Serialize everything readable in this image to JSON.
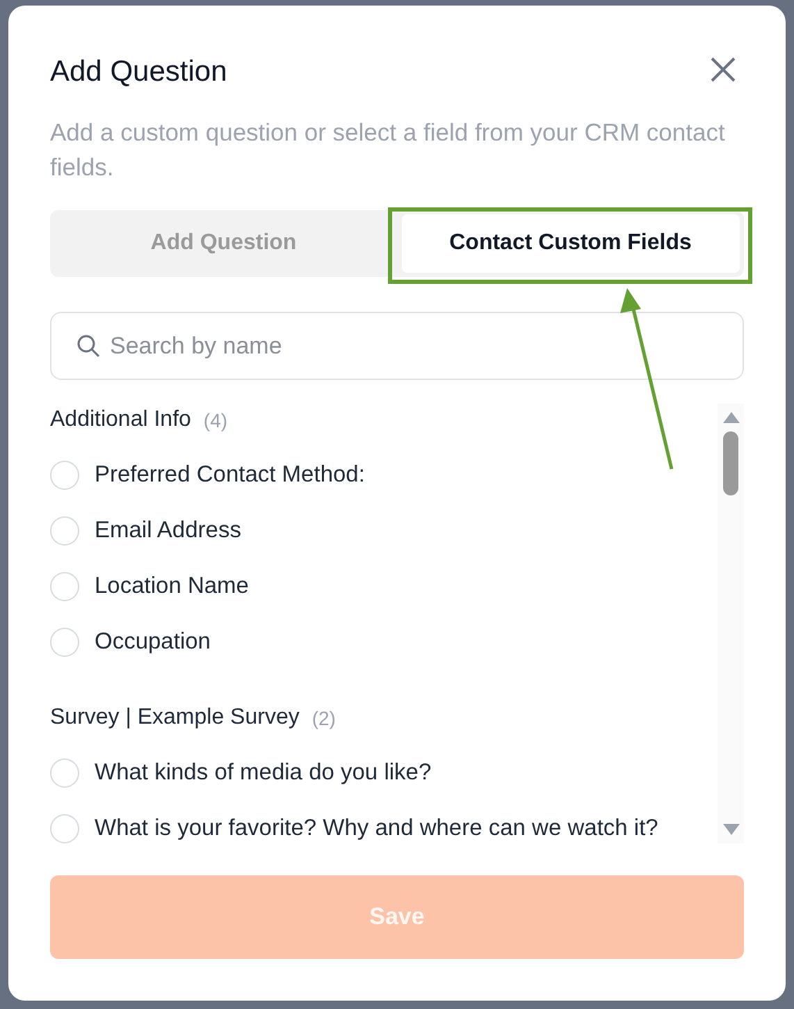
{
  "dialog": {
    "title": "Add Question",
    "description": "Add a custom question or select a field from your CRM contact fields."
  },
  "tabs": [
    {
      "label": "Add Question",
      "selected": false
    },
    {
      "label": "Contact Custom Fields",
      "selected": true
    }
  ],
  "search": {
    "placeholder": "Search by name"
  },
  "groups": [
    {
      "title": "Additional Info",
      "count": "(4)",
      "items": [
        {
          "label": "Preferred Contact Method:",
          "selected": false
        },
        {
          "label": "Email Address",
          "selected": false
        },
        {
          "label": "Location Name",
          "selected": false
        },
        {
          "label": "Occupation",
          "selected": false
        }
      ]
    },
    {
      "title": "Survey | Example Survey",
      "count": "(2)",
      "items": [
        {
          "label": "What kinds of media do you like?",
          "selected": false
        },
        {
          "label": "What is your favorite? Why and where can we watch it?",
          "selected": false
        }
      ]
    }
  ],
  "save_button": {
    "label": "Save",
    "disabled": true
  }
}
